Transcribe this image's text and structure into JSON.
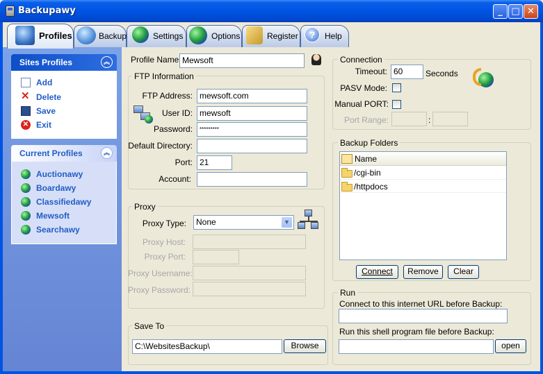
{
  "window": {
    "title": "Backupawy",
    "minimize": "_",
    "maximize": "□",
    "close": "✕"
  },
  "tabs": [
    {
      "label": "Profiles",
      "icon": "profiles-icon",
      "active": true
    },
    {
      "label": "Backup",
      "icon": "backup-icon"
    },
    {
      "label": "Settings",
      "icon": "settings-globe-icon"
    },
    {
      "label": "Options",
      "icon": "options-icon"
    },
    {
      "label": "Register",
      "icon": "register-keys-icon"
    },
    {
      "label": "Help",
      "icon": "help-icon"
    }
  ],
  "sidebar": {
    "sites_profiles": {
      "title": "Sites Profiles",
      "items": [
        {
          "label": "Add",
          "icon": "add-icon"
        },
        {
          "label": "Delete",
          "icon": "delete-icon"
        },
        {
          "label": "Save",
          "icon": "save-icon"
        },
        {
          "label": "Exit",
          "icon": "exit-icon"
        }
      ]
    },
    "current_profiles": {
      "title": "Current Profiles",
      "items": [
        "Auctionawy",
        "Boardawy",
        "Classifiedawy",
        "Mewsoft",
        "Searchawy"
      ]
    }
  },
  "profile": {
    "label": "Profile Name:",
    "value": "Mewsoft"
  },
  "ftp": {
    "title": "FTP Information",
    "address_label": "FTP Address:",
    "address": "mewsoft.com",
    "userid_label": "User ID:",
    "userid": "mewsoft",
    "password_label": "Password:",
    "password": "*********",
    "dir_label": "Default Directory:",
    "dir": "",
    "port_label": "Port:",
    "port": "21",
    "account_label": "Account:",
    "account": ""
  },
  "proxy": {
    "title": "Proxy",
    "type_label": "Proxy Type:",
    "type": "None",
    "host_label": "Proxy Host:",
    "port_label": "Proxy Port:",
    "username_label": "Proxy Username:",
    "password_label": "Proxy Password:"
  },
  "save_to": {
    "title": "Save To",
    "path": "C:\\WebsitesBackup\\",
    "browse": "Browse"
  },
  "connection": {
    "title": "Connection",
    "timeout_label": "Timeout:",
    "timeout": "60",
    "seconds": "Seconds",
    "pasv_label": "PASV Mode:",
    "manual_port_label": "Manual PORT:",
    "port_range_label": "Port Range:",
    "range_sep": ":"
  },
  "backup_folders": {
    "title": "Backup Folders",
    "column": "Name",
    "items": [
      "/cgi-bin",
      "/httpdocs"
    ],
    "connect": "Connect",
    "remove": "Remove",
    "clear": "Clear"
  },
  "run": {
    "title": "Run",
    "url_label": "Connect to this internet URL before Backup:",
    "shell_label": "Run this shell program file before Backup:",
    "open": "open"
  }
}
